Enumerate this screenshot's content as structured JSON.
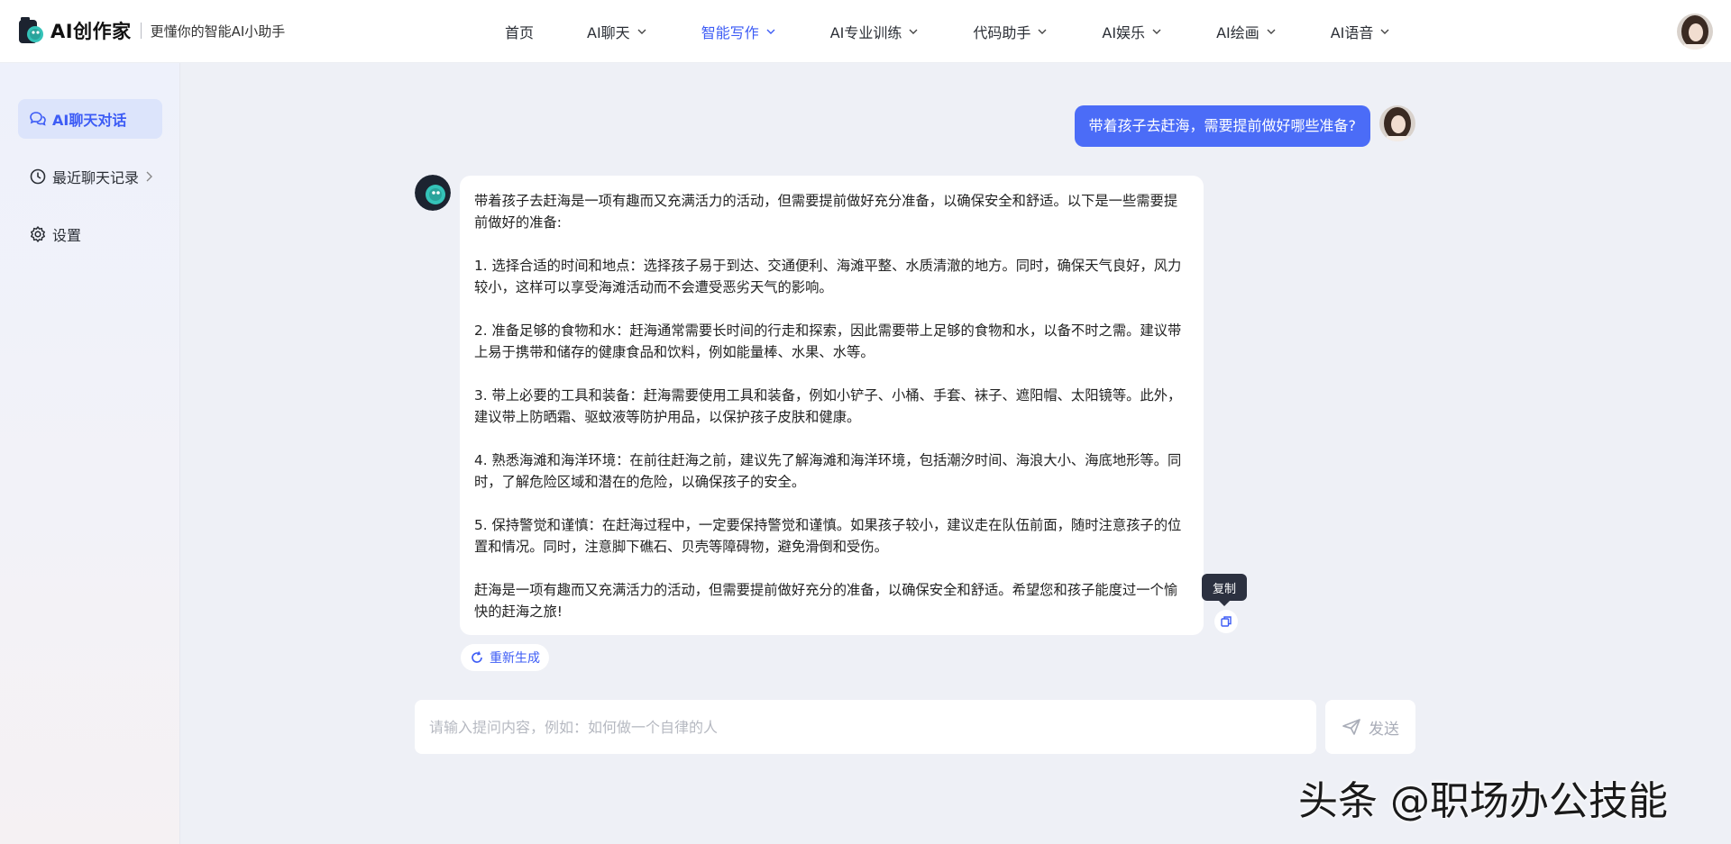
{
  "header": {
    "brand": "AI创作家",
    "slogan": "更懂你的智能AI小助手",
    "nav": [
      {
        "label": "首页",
        "has_dropdown": false,
        "active": false
      },
      {
        "label": "AI聊天",
        "has_dropdown": true,
        "active": false
      },
      {
        "label": "智能写作",
        "has_dropdown": true,
        "active": true
      },
      {
        "label": "AI专业训练",
        "has_dropdown": true,
        "active": false
      },
      {
        "label": "代码助手",
        "has_dropdown": true,
        "active": false
      },
      {
        "label": "AI娱乐",
        "has_dropdown": true,
        "active": false
      },
      {
        "label": "AI绘画",
        "has_dropdown": true,
        "active": false
      },
      {
        "label": "AI语音",
        "has_dropdown": true,
        "active": false
      }
    ]
  },
  "sidebar": {
    "items": [
      {
        "label": "AI聊天对话",
        "icon": "chat-bubbles-icon",
        "active": true
      },
      {
        "label": "最近聊天记录",
        "icon": "clock-icon",
        "active": false
      },
      {
        "label": "设置",
        "icon": "gear-icon",
        "active": false
      }
    ]
  },
  "chat": {
    "user_message": "带着孩子去赶海，需要提前做好哪些准备?",
    "bot_paragraphs": [
      "带着孩子去赶海是一项有趣而又充满活力的活动，但需要提前做好充分准备，以确保安全和舒适。以下是一些需要提前做好的准备:",
      "1. 选择合适的时间和地点：选择孩子易于到达、交通便利、海滩平整、水质清澈的地方。同时，确保天气良好，风力较小，这样可以享受海滩活动而不会遭受恶劣天气的影响。",
      "2. 准备足够的食物和水：赶海通常需要长时间的行走和探索，因此需要带上足够的食物和水，以备不时之需。建议带上易于携带和储存的健康食品和饮料，例如能量棒、水果、水等。",
      "3. 带上必要的工具和装备：赶海需要使用工具和装备，例如小铲子、小桶、手套、袜子、遮阳帽、太阳镜等。此外，建议带上防晒霜、驱蚊液等防护用品，以保护孩子皮肤和健康。",
      "4. 熟悉海滩和海洋环境：在前往赶海之前，建议先了解海滩和海洋环境，包括潮汐时间、海浪大小、海底地形等。同时，了解危险区域和潜在的危险，以确保孩子的安全。",
      "5. 保持警觉和谨慎：在赶海过程中，一定要保持警觉和谨慎。如果孩子较小，建议走在队伍前面，随时注意孩子的位置和情况。同时，注意脚下礁石、贝壳等障碍物，避免滑倒和受伤。",
      "赶海是一项有趣而又充满活力的活动，但需要提前做好充分的准备，以确保安全和舒适。希望您和孩子能度过一个愉快的赶海之旅!"
    ],
    "regenerate_label": "重新生成",
    "copy_tooltip": "复制"
  },
  "composer": {
    "placeholder": "请输入提问内容，例如：如何做一个自律的人",
    "send_label": "发送"
  },
  "watermark": "头条 @职场办公技能",
  "colors": {
    "accent": "#3d5cf5",
    "user_bubble": "#4b6cf7",
    "page_bg": "#eef0f6"
  }
}
